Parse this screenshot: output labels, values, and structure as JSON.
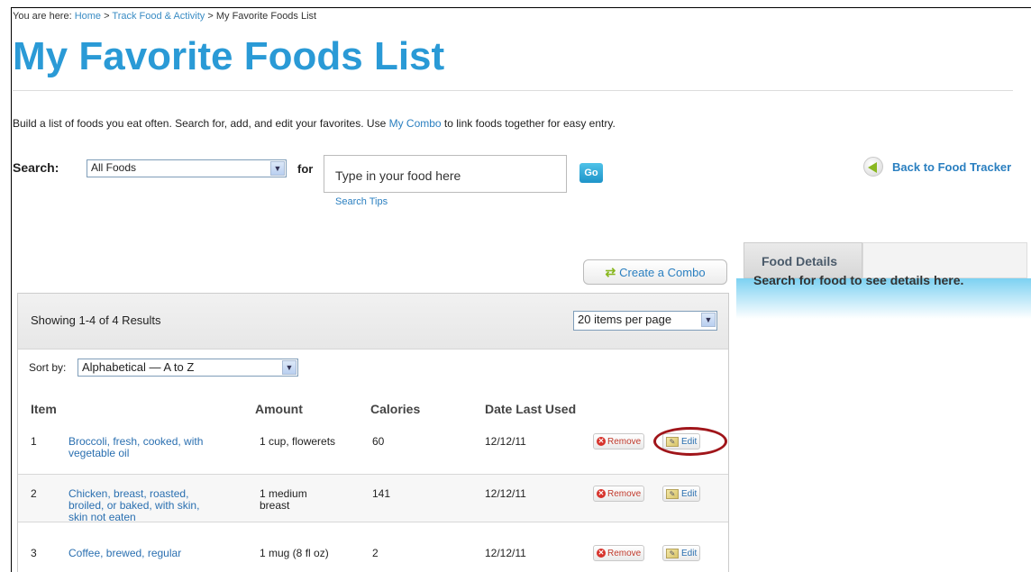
{
  "breadcrumb": {
    "prefix": "You are here: ",
    "home": "Home",
    "sep": " > ",
    "track": "Track Food & Activity",
    "current": "My Favorite Foods List"
  },
  "page_title": "My Favorite Foods List",
  "intro": {
    "before": "Build a list of foods you eat often. Search for, add, and edit your favorites. Use ",
    "link": "My Combo",
    "after": " to link foods together for easy entry."
  },
  "search": {
    "label": "Search:",
    "category": "All Foods",
    "for_label": "for",
    "placeholder": "Type in your food here",
    "go": "Go",
    "tips": "Search Tips"
  },
  "back_link": "Back to Food Tracker",
  "combo_button": "Create a Combo",
  "results": {
    "showing": "Showing 1-4 of 4 Results",
    "per_page": "20 items per page",
    "sort_label": "Sort by:",
    "sort_value": "Alphabetical — A to Z"
  },
  "columns": {
    "item": "Item",
    "amount": "Amount",
    "calories": "Calories",
    "date": "Date Last Used"
  },
  "rows": [
    {
      "num": "1",
      "name_l1": "Broccoli, fresh, cooked, with",
      "name_l2": "vegetable oil",
      "name_l3": "",
      "amount_l1": "1 cup, flowerets",
      "amount_l2": "",
      "calories": "60",
      "date": "12/12/11"
    },
    {
      "num": "2",
      "name_l1": "Chicken, breast, roasted,",
      "name_l2": "broiled, or baked, with skin,",
      "name_l3": "skin not eaten",
      "amount_l1": "1 medium",
      "amount_l2": "breast",
      "calories": "141",
      "date": "12/12/11"
    },
    {
      "num": "3",
      "name_l1": "Coffee, brewed, regular",
      "name_l2": "",
      "name_l3": "",
      "amount_l1": "1 mug (8 fl oz)",
      "amount_l2": "",
      "calories": "2",
      "date": "12/12/11"
    }
  ],
  "row_actions": {
    "remove": "Remove",
    "edit": "Edit"
  },
  "details": {
    "tab": "Food Details",
    "message": "Search for food to see details here."
  },
  "colors": {
    "title": "#2a9ad6",
    "link": "#2a7fc0",
    "highlight_circle": "#a0151a"
  },
  "icons": [
    "back-arrow-icon",
    "combo-icon",
    "remove-icon",
    "edit-pencil-icon",
    "dropdown-arrow-icon"
  ]
}
